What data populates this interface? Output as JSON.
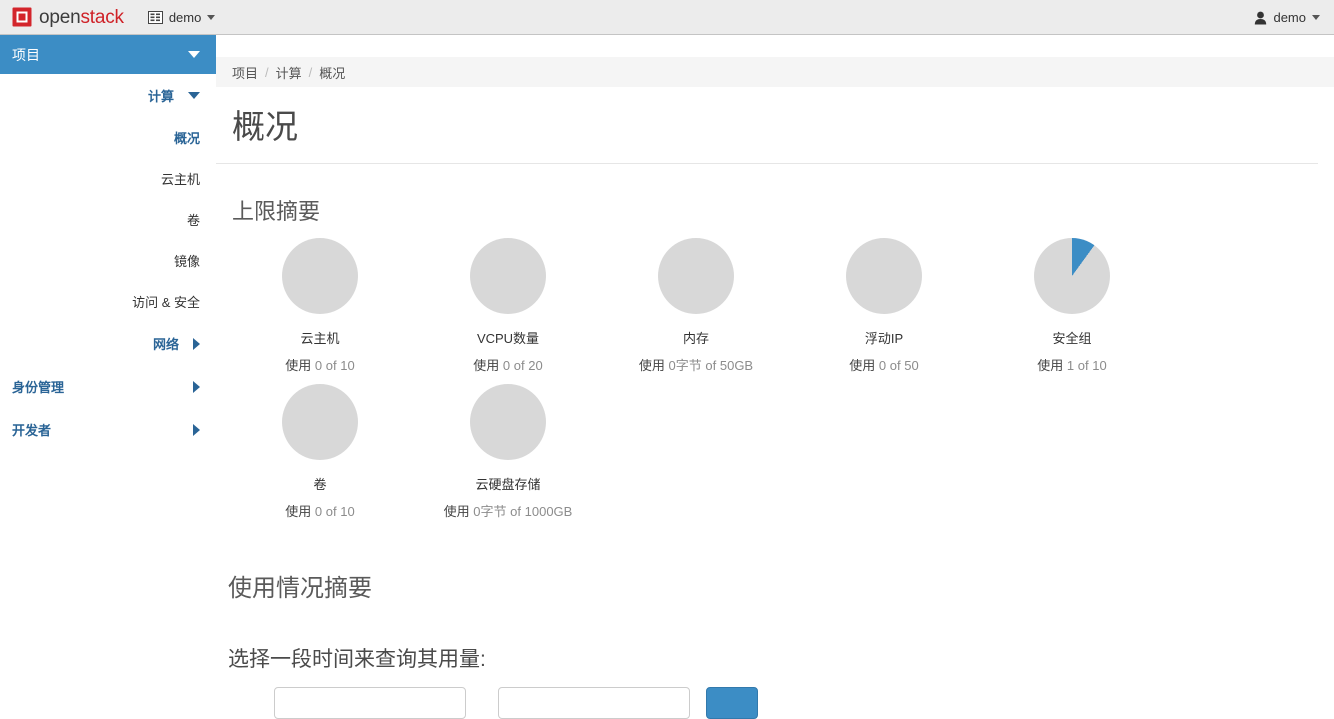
{
  "header": {
    "brand_open": "open",
    "brand_stack": "stack",
    "project_selector": "demo",
    "user_menu": "demo"
  },
  "sidebar": {
    "project": {
      "label": "项目"
    },
    "compute": {
      "label": "计算"
    },
    "items": [
      {
        "label": "概况",
        "active": true
      },
      {
        "label": "云主机",
        "active": false
      },
      {
        "label": "卷",
        "active": false
      },
      {
        "label": "镜像",
        "active": false
      },
      {
        "label": "访问 & 安全",
        "active": false
      }
    ],
    "network": {
      "label": "网络"
    },
    "identity": {
      "label": "身份管理"
    },
    "developer": {
      "label": "开发者"
    }
  },
  "breadcrumb": {
    "items": [
      "项目",
      "计算",
      "概况"
    ],
    "separator": "/"
  },
  "page": {
    "title": "概况",
    "limit_summary_heading": "上限摘要",
    "usage_summary_heading": "使用情况摘要",
    "date_prompt": "选择一段时间来查询其用量:",
    "used_prefix": "使用",
    "of_word": "of"
  },
  "form": {
    "from_value": "",
    "from_placeholder": "",
    "to_value": "",
    "to_placeholder": "",
    "submit_label": ""
  },
  "colors": {
    "accent_blue": "#3c8dc5",
    "chart_gray": "#d8d8d8",
    "brand_red": "#cf2127",
    "link_blue": "#2a6496"
  },
  "chart_data": [
    {
      "type": "pie",
      "title": "云主机",
      "used": 0,
      "limit": 10,
      "usage_text": "使用 0 of 10",
      "used_label": "0",
      "limit_label": "10",
      "percent": 0
    },
    {
      "type": "pie",
      "title": "VCPU数量",
      "used": 0,
      "limit": 20,
      "usage_text": "使用 0 of 20",
      "used_label": "0",
      "limit_label": "20",
      "percent": 0
    },
    {
      "type": "pie",
      "title": "内存",
      "used": 0,
      "limit": 50,
      "usage_text": "使用 0字节 of 50GB",
      "used_label": "0字节",
      "limit_label": "50GB",
      "percent": 0
    },
    {
      "type": "pie",
      "title": "浮动IP",
      "used": 0,
      "limit": 50,
      "usage_text": "使用 0 of 50",
      "used_label": "0",
      "limit_label": "50",
      "percent": 0
    },
    {
      "type": "pie",
      "title": "安全组",
      "used": 1,
      "limit": 10,
      "usage_text": "使用 1 of 10",
      "used_label": "1",
      "limit_label": "10",
      "percent": 10
    },
    {
      "type": "pie",
      "title": "卷",
      "used": 0,
      "limit": 10,
      "usage_text": "使用 0 of 10",
      "used_label": "0",
      "limit_label": "10",
      "percent": 0
    },
    {
      "type": "pie",
      "title": "云硬盘存储",
      "used": 0,
      "limit": 1000,
      "usage_text": "使用 0字节 of 1000GB",
      "used_label": "0字节",
      "limit_label": "1000GB",
      "percent": 0
    }
  ]
}
